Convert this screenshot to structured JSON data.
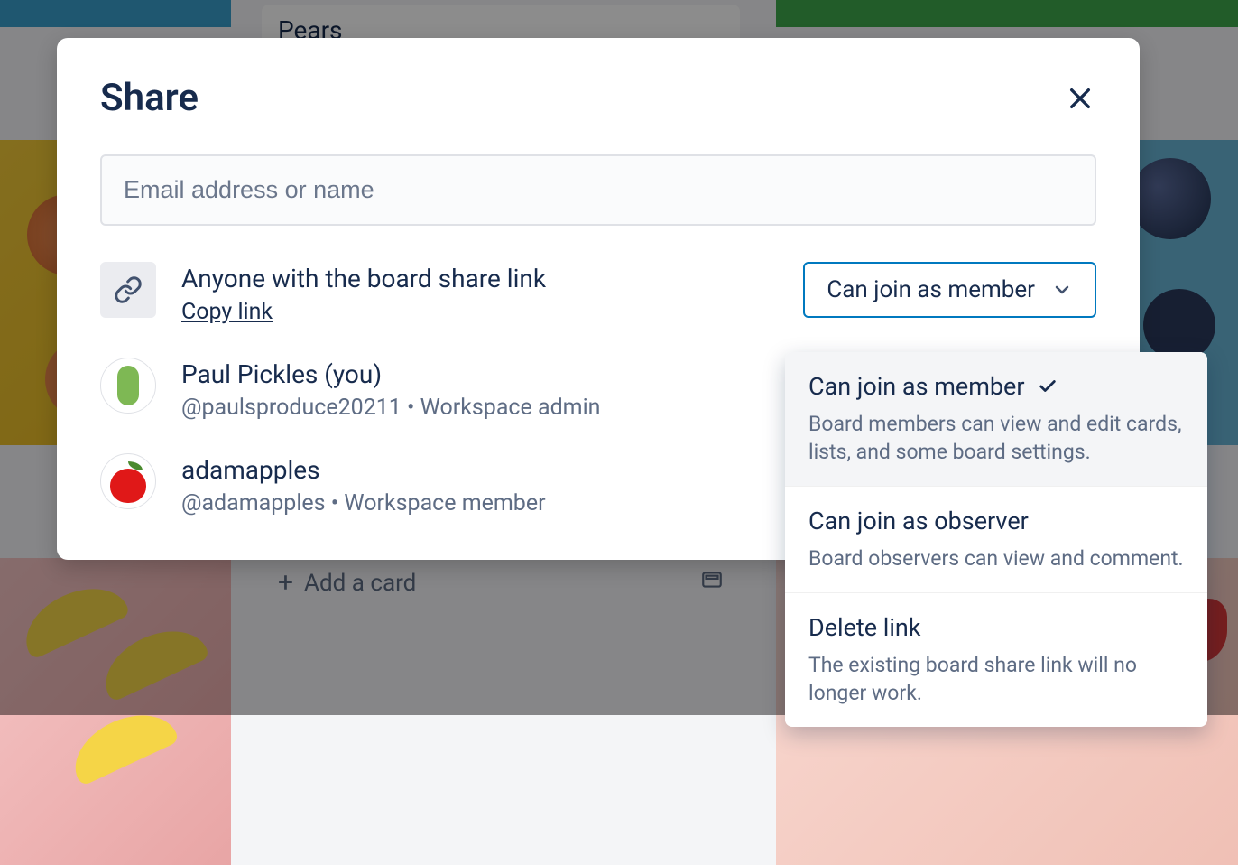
{
  "background": {
    "card_label": "Pears",
    "add_card_label": "Add a card"
  },
  "modal": {
    "title": "Share",
    "input_placeholder": "Email address or name",
    "link_row": {
      "title": "Anyone with the board share link",
      "copy_label": "Copy link"
    },
    "members": [
      {
        "name": "Paul Pickles (you)",
        "meta": "@paulsproduce20211 • Workspace admin"
      },
      {
        "name": "adamapples",
        "meta": "@adamapples • Workspace member"
      }
    ],
    "dropdown": {
      "selected_label": "Can join as member",
      "options": [
        {
          "title": "Can join as member",
          "desc": "Board members can view and edit cards, lists, and some board settings.",
          "selected": true
        },
        {
          "title": "Can join as observer",
          "desc": "Board observers can view and comment.",
          "selected": false
        },
        {
          "title": "Delete link",
          "desc": "The existing board share link will no longer work.",
          "selected": false
        }
      ]
    }
  }
}
